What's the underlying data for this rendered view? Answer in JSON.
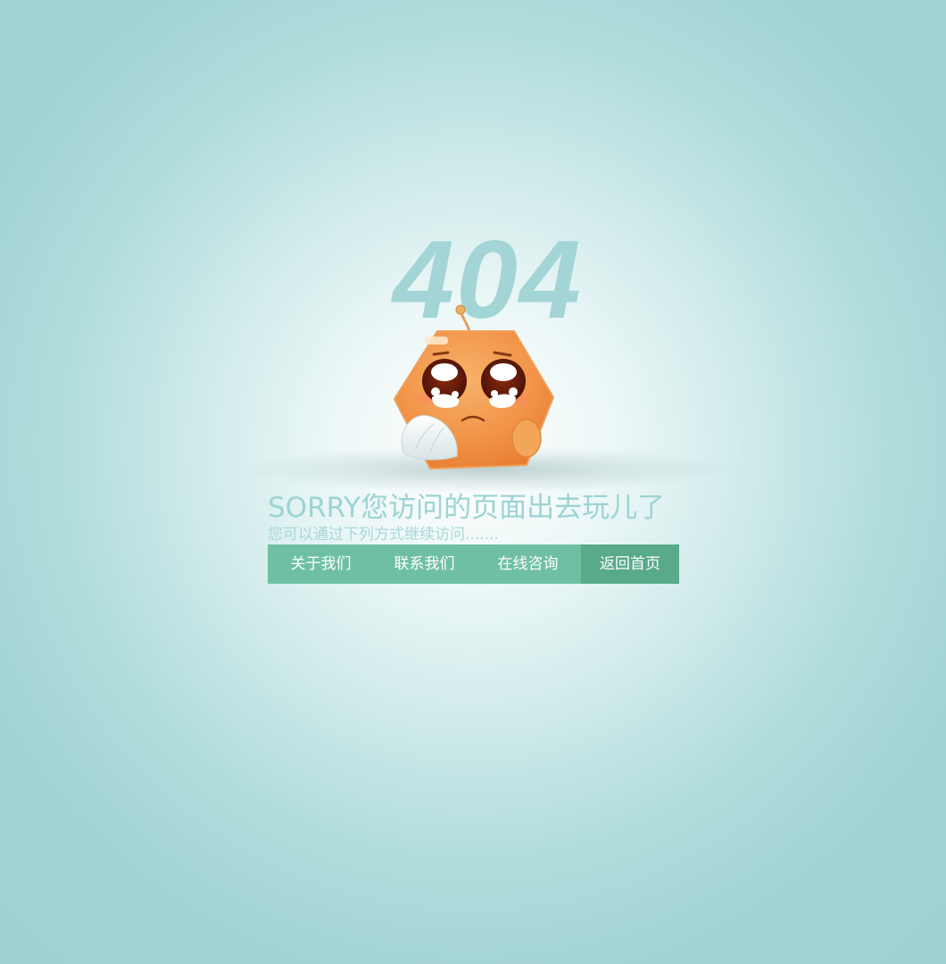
{
  "error_code": "404",
  "headline": "SORRY您访问的页面出去玩儿了",
  "subline": "您可以通过下列方式继续访问.......",
  "nav": {
    "items": [
      {
        "label": "关于我们"
      },
      {
        "label": "联系我们"
      },
      {
        "label": "在线咨询"
      },
      {
        "label": "返回首页"
      }
    ],
    "active_index": 3
  },
  "colors": {
    "accent_text": "#9dd3d3",
    "nav_bg": "#6fc0a3",
    "nav_active_bg": "#59a98b",
    "mascot_orange": "#f29a4e"
  },
  "icons": [
    "crying-orange-mascot"
  ]
}
